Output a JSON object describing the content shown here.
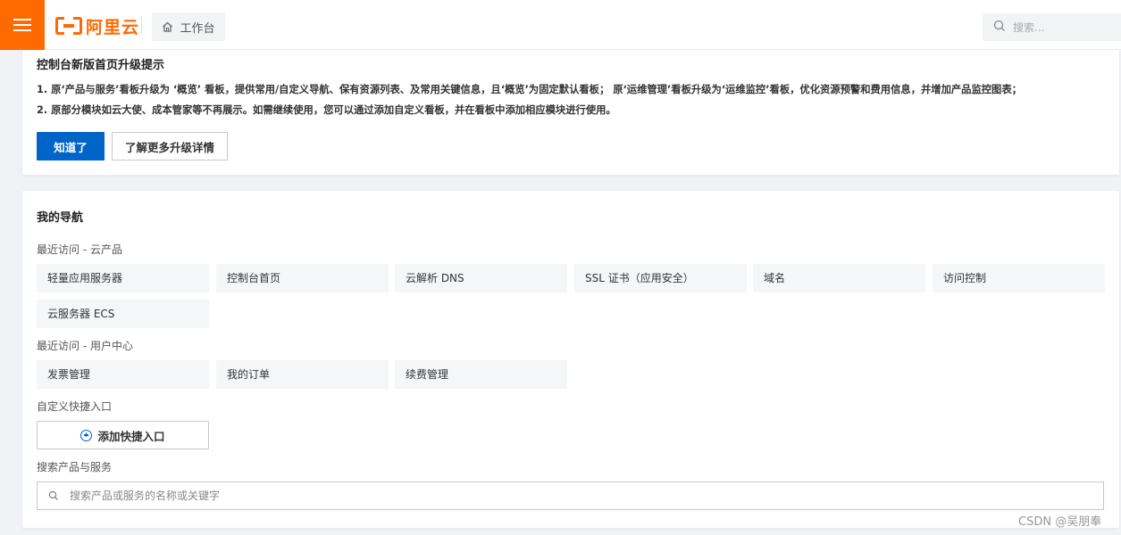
{
  "header": {
    "logo_text": "阿里云",
    "workbench_label": "工作台",
    "search_placeholder": "搜索..."
  },
  "notice": {
    "title": "控制台新版首页升级提示",
    "line1": "1. 原‘产品与服务’看板升级为 ‘概览’ 看板，提供常用/自定义导航、保有资源列表、及常用关键信息，且‘概览’为固定默认看板； 原‘运维管理’看板升级为‘运维监控’看板，优化资源预警和费用信息，并增加产品监控图表；",
    "line2": "2. 原部分模块如云大使、成本管家等不再展示。如需继续使用，您可以通过添加自定义看板，并在看板中添加相应模块进行使用。",
    "ok_label": "知道了",
    "more_label": "了解更多升级详情"
  },
  "nav": {
    "title": "我的导航",
    "recent_products_label": "最近访问 - 云产品",
    "recent_products": [
      "轻量应用服务器",
      "控制台首页",
      "云解析 DNS",
      "SSL 证书（应用安全）",
      "域名",
      "访问控制",
      "云服务器 ECS"
    ],
    "recent_user_label": "最近访问 - 用户中心",
    "recent_user": [
      "发票管理",
      "我的订单",
      "续费管理"
    ],
    "custom_label": "自定义快捷入口",
    "add_shortcut_label": "添加快捷入口",
    "search_label": "搜索产品与服务",
    "search_placeholder": "搜索产品或服务的名称或关键字"
  },
  "watermark": "CSDN @吴朋奉",
  "colors": {
    "brand": "#ff6a00",
    "primary": "#0064c8"
  }
}
